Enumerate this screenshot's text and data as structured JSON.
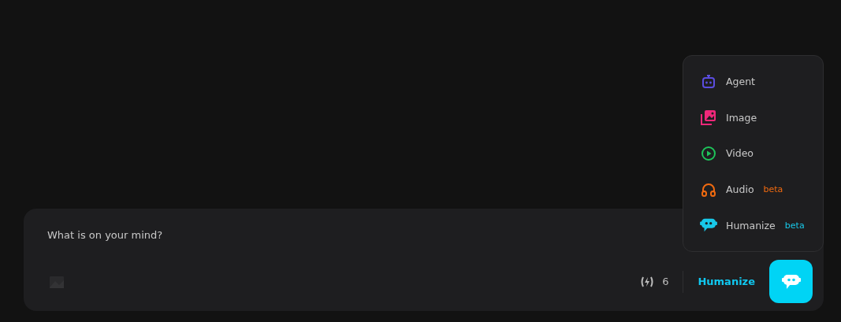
{
  "composer": {
    "placeholder": "What is on your mind?",
    "credits": "6",
    "mode_label": "Humanize"
  },
  "menu": [
    {
      "kind": "agent",
      "label": "Agent",
      "color": "#5b4de0"
    },
    {
      "kind": "image",
      "label": "Image",
      "color": "#f0287a"
    },
    {
      "kind": "video",
      "label": "Video",
      "color": "#1ec45a"
    },
    {
      "kind": "audio",
      "label": "Audio",
      "color": "#f06a10",
      "badge": "beta"
    },
    {
      "kind": "humanize",
      "label": "Humanize",
      "color": "#18c8e8",
      "badge": "beta"
    }
  ]
}
